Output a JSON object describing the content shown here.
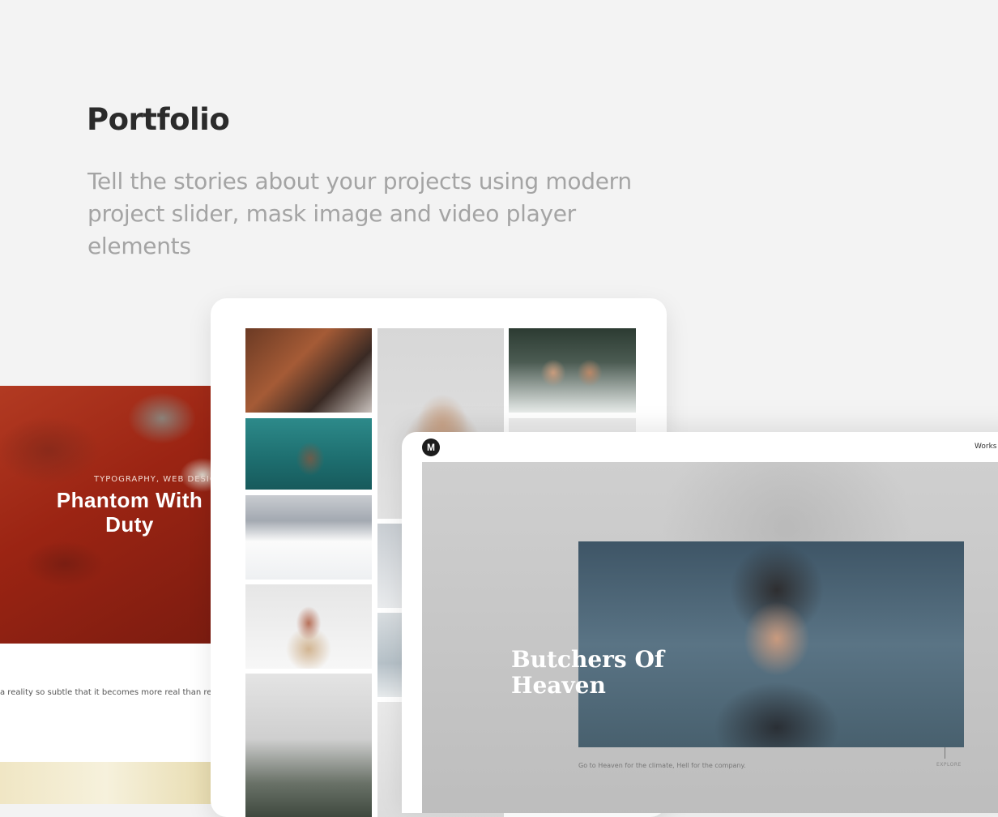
{
  "header": {
    "title": "Portfolio",
    "subtitle_line1": "Tell the stories about your projects using modern",
    "subtitle_line2": "project slider, mask image and video player elements"
  },
  "left_card": {
    "tags": "TYPOGRAPHY, WEB DESIGN",
    "title_line1": "Phantom With",
    "title_line2": "Duty",
    "quote": "a reality so subtle that it becomes more real than reality.\""
  },
  "gallery_card": {
    "tiles": [
      "couple-in-snow",
      "ocean-rock",
      "snowy-mountains",
      "woman-in-hood",
      "misty-forest",
      "woman-portrait",
      "winter-landscape",
      "frozen-lake",
      "snow-field",
      "couple-selfie",
      "blank"
    ]
  },
  "player_card": {
    "logo": "M",
    "nav_link": "Works",
    "title_line1": "Butchers Of",
    "title_line2": "Heaven",
    "caption": "Go to Heaven for the climate, Hell for the company.",
    "explore_label": "EXPLORE"
  }
}
